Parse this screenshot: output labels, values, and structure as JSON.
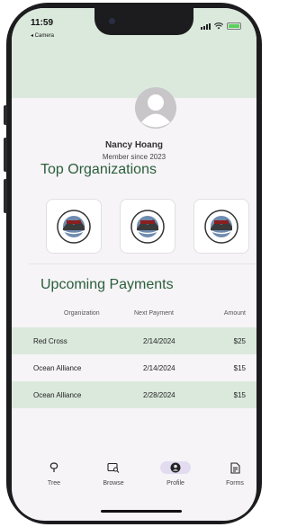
{
  "status_bar": {
    "time": "11:59",
    "back_app": "◂ Camera"
  },
  "profile": {
    "name": "Nancy Hoang",
    "member_since": "Member since 2023"
  },
  "top_organizations": {
    "title": "Top Organizations",
    "items": [
      {
        "logo": "ocean-alliance-logo"
      },
      {
        "logo": "ocean-alliance-logo"
      },
      {
        "logo": "ocean-alliance-logo"
      }
    ]
  },
  "payments": {
    "title": "Upcoming Payments",
    "columns": [
      "Organization",
      "Next Payment",
      "Amount"
    ],
    "rows": [
      {
        "organization": "Red Cross",
        "next_payment": "2/14/2024",
        "amount": "$25"
      },
      {
        "organization": "Ocean Alliance",
        "next_payment": "2/14/2024",
        "amount": "$15"
      },
      {
        "organization": "Ocean Alliance",
        "next_payment": "2/28/2024",
        "amount": "$15"
      }
    ]
  },
  "tabs": [
    {
      "label": "Tree",
      "icon": "tree-icon",
      "active": false
    },
    {
      "label": "Browse",
      "icon": "browse-icon",
      "active": false
    },
    {
      "label": "Profile",
      "icon": "profile-icon",
      "active": true
    },
    {
      "label": "Forms",
      "icon": "forms-icon",
      "active": false
    }
  ],
  "colors": {
    "accent_green": "#dbe9dd",
    "heading_green": "#2a5e3a",
    "active_tab": "#e3dcf0"
  }
}
